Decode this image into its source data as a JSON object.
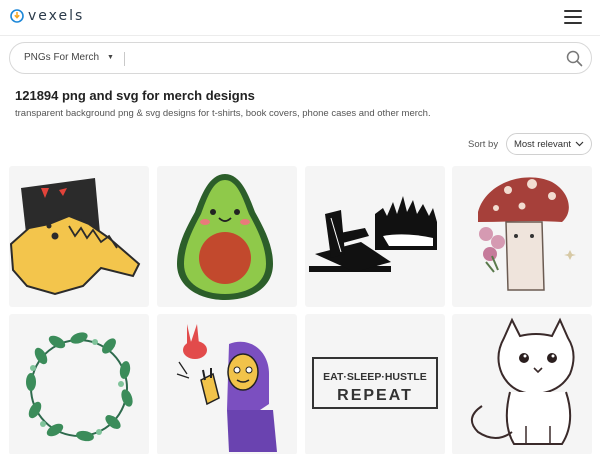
{
  "header": {
    "brand": "vexels",
    "menu_icon": "hamburger-menu-icon"
  },
  "search": {
    "type_label": "PNGs For Merch",
    "placeholder": "",
    "icon": "search-icon"
  },
  "results": {
    "title": "121894 png and svg for merch designs",
    "subtitle": "transparent background png & svg designs for t-shirts, book covers, phone cases and other merch."
  },
  "sort": {
    "label": "Sort by",
    "selected": "Most relevant"
  },
  "designs": [
    {
      "name": "crocodile-design"
    },
    {
      "name": "avocado-design"
    },
    {
      "name": "lake-chair-silhouette-design"
    },
    {
      "name": "mushroom-cat-design"
    },
    {
      "name": "leaf-wreath-design"
    },
    {
      "name": "hooded-character-design"
    },
    {
      "name": "eat-sleep-hustle-repeat-design",
      "line1": "EAT·SLEEP·HUSTLE",
      "line2": "REPEAT"
    },
    {
      "name": "cute-cat-outline-design"
    }
  ]
}
